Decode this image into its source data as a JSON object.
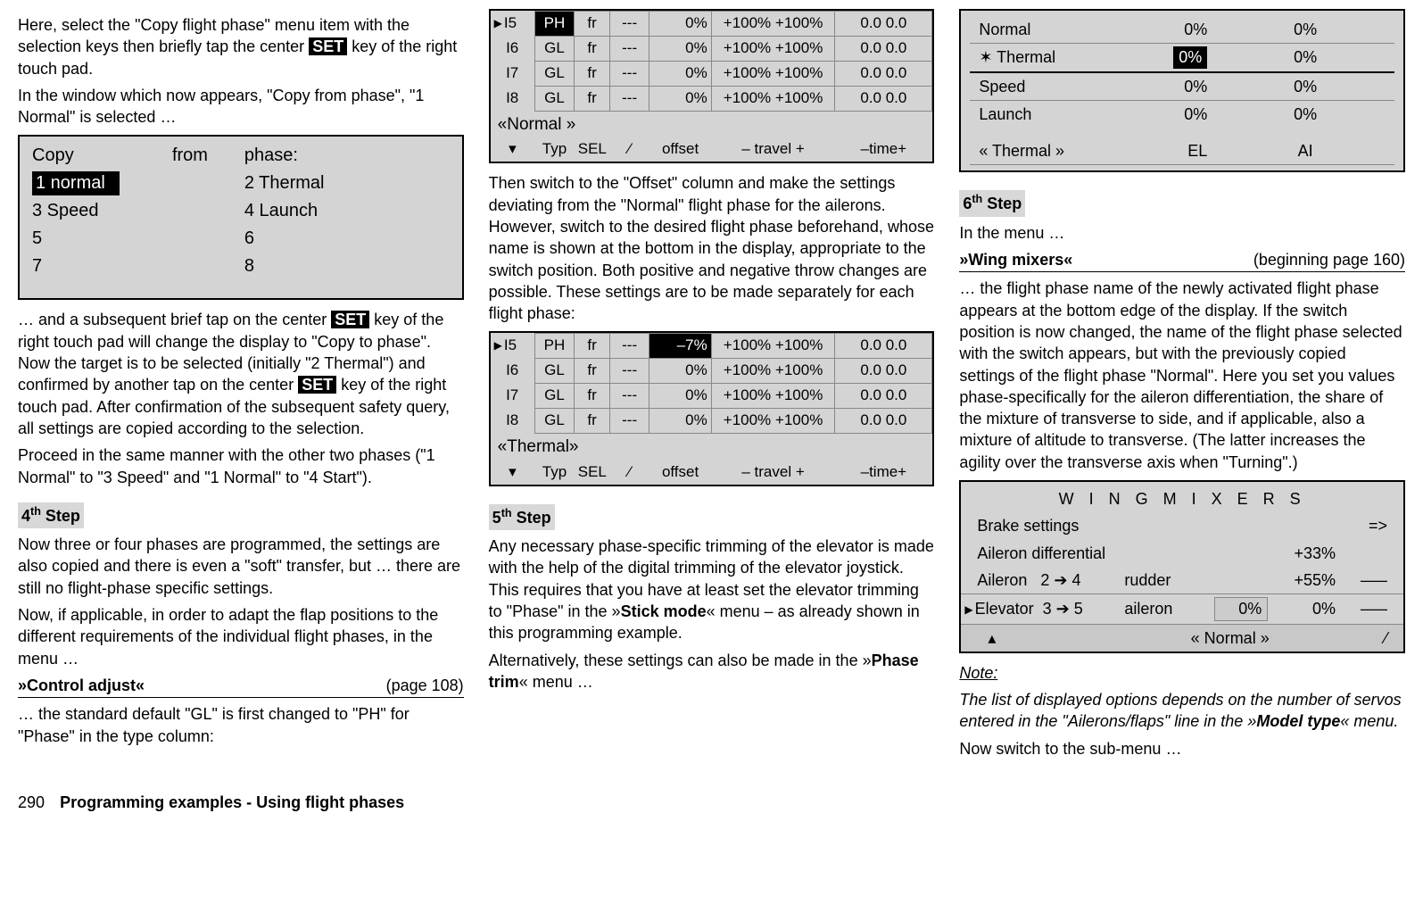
{
  "col1": {
    "p1a": "Here, select the \"Copy flight phase\" menu item with the selection keys then briefly tap the center ",
    "set": "SET",
    "p1b": " key of the right touch pad.",
    "p2": "In the window which now appears, \"Copy from phase\", \"1 Normal\" is selected …",
    "copy_screen": {
      "hdr_copy": "Copy",
      "hdr_from": "from",
      "hdr_phase": "phase:",
      "r1a": "1  normal",
      "r1b": "2  Thermal",
      "r2a": "3  Speed",
      "r2b": "4  Launch",
      "r3a": "5",
      "r3b": "6",
      "r4a": "7",
      "r4b": "8"
    },
    "p3a": "… and a subsequent brief tap on the center ",
    "p3b": " key of the right touch pad will change the display to \"Copy to phase\". Now the target is to be selected (initially \"2 Thermal\") and confirmed by another tap on the center ",
    "p3c": " key of the right touch pad. After confirmation of the subsequent safety query, all settings are copied according to the selection.",
    "p4": "Proceed in the same manner with the other two phases (\"1 Normal\" to \"3 Speed\" and \"1 Normal\" to \"4 Start\").",
    "step4_label": "4",
    "step4_suffix": "th",
    "step_word": " Step",
    "p5": "Now three or four phases are programmed, the settings are also copied and there is even a \"soft\" transfer, but … there are still no flight-phase specific settings.",
    "p6": "Now, if applicable, in order to adapt the flap positions to the different requirements of the individual flight phases, in the menu …",
    "menu1": "»Control adjust«",
    "menu1_page": "(page 108)",
    "p7": "… the standard default \"GL\" is first changed to \"PH\" for \"Phase\" in the type column:"
  },
  "col2": {
    "table1": {
      "rows": [
        {
          "id": "I5",
          "typ": "PH",
          "sel": "fr",
          "sw": "---",
          "off": "0%",
          "tn": "+100%",
          "tp": "+100%",
          "tm": "0.0 0.0",
          "marker": true,
          "inv": "typ"
        },
        {
          "id": "I6",
          "typ": "GL",
          "sel": "fr",
          "sw": "---",
          "off": "0%",
          "tn": "+100%",
          "tp": "+100%",
          "tm": "0.0 0.0"
        },
        {
          "id": "I7",
          "typ": "GL",
          "sel": "fr",
          "sw": "---",
          "off": "0%",
          "tn": "+100%",
          "tp": "+100%",
          "tm": "0.0 0.0"
        },
        {
          "id": "I8",
          "typ": "GL",
          "sel": "fr",
          "sw": "---",
          "off": "0%",
          "tn": "+100%",
          "tp": "+100%",
          "tm": "0.0 0.0"
        }
      ],
      "phase": "«Normal  »",
      "footer": {
        "c1": "▾",
        "c2": "Typ",
        "c3": "SEL",
        "c4": "⁄",
        "c5": "offset",
        "c6": "– travel +",
        "c7": "–time+"
      }
    },
    "p1": "Then switch to the \"Offset\" column and make the settings deviating from the \"Normal\" flight phase for the ailerons. However, switch to the desired flight phase beforehand, whose name is shown at the bottom in the display, appropriate to the switch position. Both positive and negative throw changes are possible. These settings are to be made separately for each flight phase:",
    "table2": {
      "rows": [
        {
          "id": "I5",
          "typ": "PH",
          "sel": "fr",
          "sw": "---",
          "off": "–7%",
          "tn": "+100%",
          "tp": "+100%",
          "tm": "0.0 0.0",
          "marker": true,
          "inv": "off"
        },
        {
          "id": "I6",
          "typ": "GL",
          "sel": "fr",
          "sw": "---",
          "off": "0%",
          "tn": "+100%",
          "tp": "+100%",
          "tm": "0.0 0.0"
        },
        {
          "id": "I7",
          "typ": "GL",
          "sel": "fr",
          "sw": "---",
          "off": "0%",
          "tn": "+100%",
          "tp": "+100%",
          "tm": "0.0 0.0"
        },
        {
          "id": "I8",
          "typ": "GL",
          "sel": "fr",
          "sw": "---",
          "off": "0%",
          "tn": "+100%",
          "tp": "+100%",
          "tm": "0.0 0.0"
        }
      ],
      "phase": "«Thermal»",
      "footer": {
        "c1": "▾",
        "c2": "Typ",
        "c3": "SEL",
        "c4": "⁄",
        "c5": "offset",
        "c6": "– travel +",
        "c7": "–time+"
      }
    },
    "step5_label": "5",
    "step5_suffix": "th",
    "p2a": "Any necessary phase-specific trimming of the elevator is made with the help of the digital trimming of the elevator joystick. This requires that you have at least set the elevator trimming to \"Phase\" in the »",
    "p2bold1": "Stick mode",
    "p2b": "« menu – as already shown in this programming example.",
    "p3a": "Alternatively, these settings can also be made in the »",
    "p3bold": "Phase trim",
    "p3b": "« menu …"
  },
  "col3": {
    "pt": {
      "h1": "Normal",
      "h2": "0%",
      "h3": "0%",
      "r2a": "Thermal",
      "r2b": "0%",
      "r2c": "0%",
      "r3a": "Speed",
      "r3b": "0%",
      "r3c": "0%",
      "r4a": "Launch",
      "r4b": "0%",
      "r4c": "0%",
      "f1": "« Thermal »",
      "f2": "EL",
      "f3": "AI"
    },
    "step6_label": "6",
    "step6_suffix": "th",
    "p1": "In the menu …",
    "menu": "»Wing mixers«",
    "menu_page": "(beginning page 160)",
    "p2": "… the flight phase name of the newly activated flight phase appears at the bottom edge of the display. If the switch position is now changed, the name of the flight phase selected with the switch appears, but with the previously copied settings of the flight phase \"Normal\". Here you set you values phase-specifically for the aileron differentiation, the share of the mixture of transverse to side, and if applicable, also a mixture of altitude to transverse. (The latter increases the agility over the transverse axis when \"Turning\".)",
    "wing": {
      "title": "W I N G   M I X E R S",
      "r1a": "Brake settings",
      "r1b": "",
      "r1c": "=>",
      "r2a": "Aileron differential",
      "r2b": "+33%",
      "r2c": "",
      "r3a": "Aileron",
      "r3a2": "2",
      "r3a3": "4",
      "r3a4": "rudder",
      "r3b": "+55%",
      "r3c": "–––",
      "r4a": "Elevator",
      "r4a2": "3",
      "r4a3": "5",
      "r4a4": "aileron",
      "r4b": "0%",
      "r4c": "0%",
      "r4d": "–––",
      "foot_l": "▴",
      "foot_c": "« Normal  »",
      "foot_r": "⁄"
    },
    "note_head": "Note:",
    "note_a": "The list of displayed options depends on the number of servos entered in the \"Ailerons/flaps\" line in the »",
    "note_bold": "Model type",
    "note_b": "« menu.",
    "p3": "Now switch to the sub-menu …"
  },
  "footer": {
    "page": "290",
    "title": "Programming examples - Using flight phases"
  }
}
